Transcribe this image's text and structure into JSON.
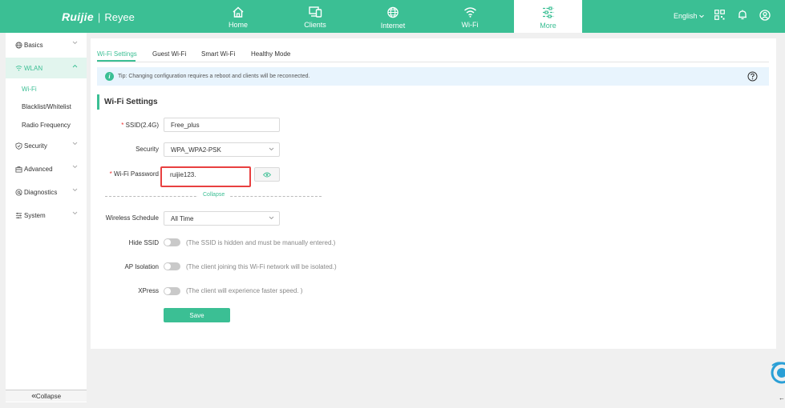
{
  "brand": {
    "logo_text": "Ruijie",
    "separator": "|",
    "product_text": "Reyee"
  },
  "nav": [
    {
      "label": "Home",
      "icon": "home-icon"
    },
    {
      "label": "Clients",
      "icon": "clients-icon"
    },
    {
      "label": "Internet",
      "icon": "globe-icon"
    },
    {
      "label": "Wi-Fi",
      "icon": "wifi-icon"
    },
    {
      "label": "More",
      "icon": "sliders-icon",
      "active": true
    }
  ],
  "topbar": {
    "language": "English",
    "icons": [
      "qr-code-icon",
      "bell-icon",
      "user-icon"
    ]
  },
  "sidebar": {
    "items": [
      {
        "label": "Basics",
        "icon": "globe-icon"
      },
      {
        "label": "WLAN",
        "icon": "wifi-icon",
        "active": true
      },
      {
        "label": "Security",
        "icon": "shield-icon"
      },
      {
        "label": "Advanced",
        "icon": "briefcase-icon"
      },
      {
        "label": "Diagnostics",
        "icon": "stethoscope-icon"
      },
      {
        "label": "System",
        "icon": "system-icon"
      }
    ],
    "wlan_children": [
      {
        "label": "Wi-Fi",
        "active": true
      },
      {
        "label": "Blacklist/Whitelist"
      },
      {
        "label": "Radio Frequency"
      }
    ],
    "collapse_label": "Collapse"
  },
  "tabs": [
    {
      "label": "Wi-Fi Settings",
      "active": true
    },
    {
      "label": "Guest Wi-Fi"
    },
    {
      "label": "Smart Wi-Fi"
    },
    {
      "label": "Healthy Mode"
    }
  ],
  "tip": {
    "text": "Tip: Changing configuration requires a reboot and clients will be reconnected."
  },
  "section_title": "Wi-Fi Settings",
  "form": {
    "ssid": {
      "label": "SSID(2.4G)",
      "required": "*",
      "value": "Free_plus"
    },
    "security": {
      "label": "Security",
      "value": "WPA_WPA2-PSK"
    },
    "password": {
      "label": "Wi-Fi Password",
      "required": "*",
      "value": "ruijie123."
    },
    "collapse_label": "Collapse",
    "schedule": {
      "label": "Wireless Schedule",
      "value": "All Time"
    },
    "hide_ssid": {
      "label": "Hide SSID",
      "enabled": false,
      "hint": "(The SSID is hidden and must be manually entered.)"
    },
    "ap_isolation": {
      "label": "AP Isolation",
      "enabled": false,
      "hint": "(The client joining this Wi-Fi network will be isolated.)"
    },
    "xpress": {
      "label": "XPress",
      "enabled": false,
      "hint": "(The client will experience faster speed. )"
    },
    "save_label": "Save"
  },
  "colors": {
    "accent": "#3bbf94",
    "highlight_border": "#e84040",
    "tip_bg": "#e8f4fd"
  }
}
